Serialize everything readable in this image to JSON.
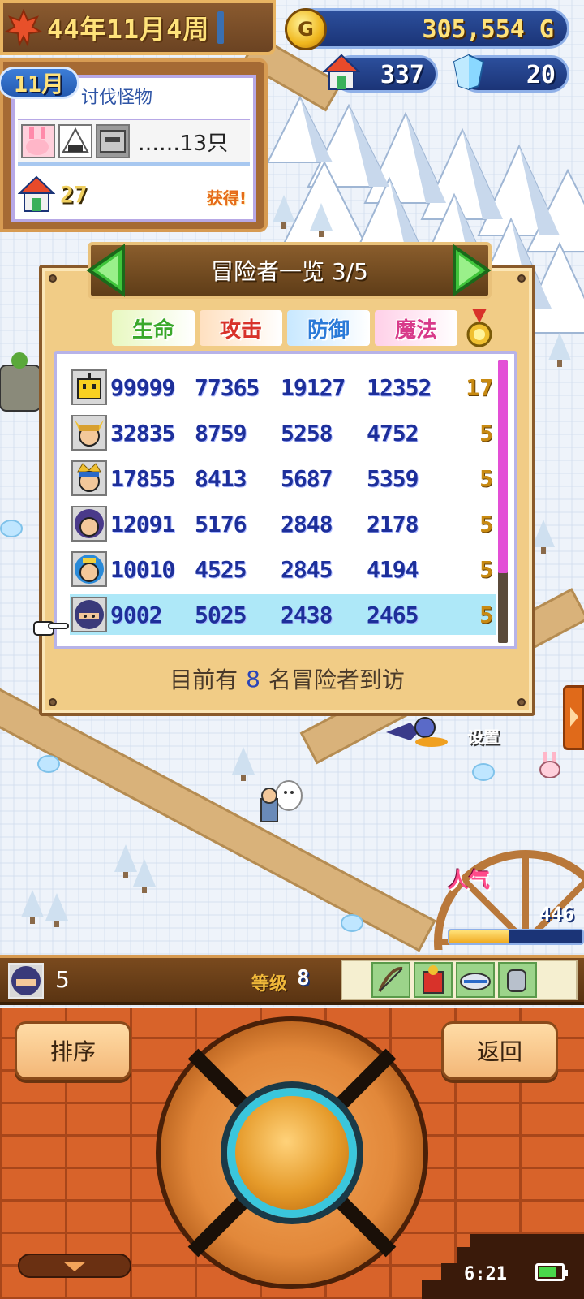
{
  "hud": {
    "date": "44年11月4周",
    "gold": "305,554 G",
    "coin_symbol": "G",
    "houses": "337",
    "crystals": "20"
  },
  "quest": {
    "month": "11月",
    "title": "讨伐怪物",
    "count": "……13只",
    "reward": "27",
    "obtain_label": "获得!"
  },
  "panel": {
    "title": "冒险者一览 3/5",
    "headers": [
      "生命",
      "攻击",
      "防御",
      "魔法"
    ],
    "header_colors": [
      "#3aa82a",
      "#d8322a",
      "#2a7ad8",
      "#d83a8a"
    ],
    "rows": [
      {
        "avatar": "yellow-box-icon",
        "hp": "99999",
        "atk": "77365",
        "def": "19127",
        "mag": "12352",
        "lvl": "17"
      },
      {
        "avatar": "horned-warrior-icon",
        "hp": "32835",
        "atk": "8759",
        "def": "5258",
        "mag": "4752",
        "lvl": "5"
      },
      {
        "avatar": "crowned-warrior-icon",
        "hp": "17855",
        "atk": "8413",
        "def": "5687",
        "mag": "5359",
        "lvl": "5"
      },
      {
        "avatar": "hooded-hero-icon",
        "hp": "12091",
        "atk": "5176",
        "def": "2848",
        "mag": "2178",
        "lvl": "5"
      },
      {
        "avatar": "blue-mage-icon",
        "hp": "10010",
        "atk": "4525",
        "def": "2845",
        "mag": "4194",
        "lvl": "5"
      },
      {
        "avatar": "ninja-icon",
        "hp": "9002",
        "atk": "5025",
        "def": "2438",
        "mag": "2465",
        "lvl": "5"
      }
    ],
    "selected_row": 5,
    "footer_prefix": "目前有",
    "footer_count": "8",
    "footer_suffix": "名冒险者到访"
  },
  "popularity": {
    "label": "人气",
    "value": "446",
    "level": 0.45
  },
  "map_label": "设置",
  "selected": {
    "name": "5",
    "level_label": "等级",
    "level": "8",
    "equipment": [
      "bow-icon",
      "red-armor-icon",
      "helmet-icon",
      "gauntlet-icon"
    ]
  },
  "buttons": {
    "sort": "排序",
    "back": "返回"
  },
  "status": {
    "time": "6:21"
  }
}
